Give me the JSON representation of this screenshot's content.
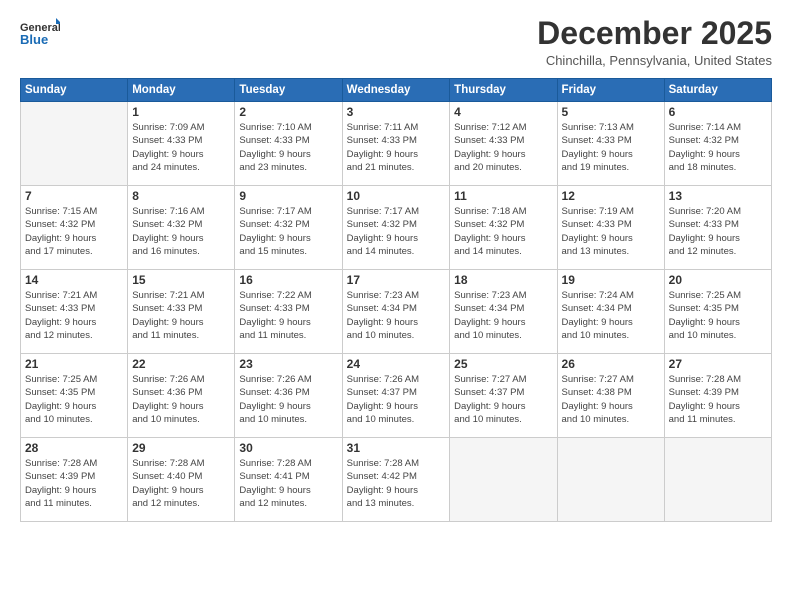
{
  "header": {
    "logo_line1": "General",
    "logo_line2": "Blue",
    "month": "December 2025",
    "location": "Chinchilla, Pennsylvania, United States"
  },
  "weekdays": [
    "Sunday",
    "Monday",
    "Tuesday",
    "Wednesday",
    "Thursday",
    "Friday",
    "Saturday"
  ],
  "weeks": [
    [
      {
        "day": "",
        "info": ""
      },
      {
        "day": "1",
        "info": "Sunrise: 7:09 AM\nSunset: 4:33 PM\nDaylight: 9 hours\nand 24 minutes."
      },
      {
        "day": "2",
        "info": "Sunrise: 7:10 AM\nSunset: 4:33 PM\nDaylight: 9 hours\nand 23 minutes."
      },
      {
        "day": "3",
        "info": "Sunrise: 7:11 AM\nSunset: 4:33 PM\nDaylight: 9 hours\nand 21 minutes."
      },
      {
        "day": "4",
        "info": "Sunrise: 7:12 AM\nSunset: 4:33 PM\nDaylight: 9 hours\nand 20 minutes."
      },
      {
        "day": "5",
        "info": "Sunrise: 7:13 AM\nSunset: 4:33 PM\nDaylight: 9 hours\nand 19 minutes."
      },
      {
        "day": "6",
        "info": "Sunrise: 7:14 AM\nSunset: 4:32 PM\nDaylight: 9 hours\nand 18 minutes."
      }
    ],
    [
      {
        "day": "7",
        "info": "Sunrise: 7:15 AM\nSunset: 4:32 PM\nDaylight: 9 hours\nand 17 minutes."
      },
      {
        "day": "8",
        "info": "Sunrise: 7:16 AM\nSunset: 4:32 PM\nDaylight: 9 hours\nand 16 minutes."
      },
      {
        "day": "9",
        "info": "Sunrise: 7:17 AM\nSunset: 4:32 PM\nDaylight: 9 hours\nand 15 minutes."
      },
      {
        "day": "10",
        "info": "Sunrise: 7:17 AM\nSunset: 4:32 PM\nDaylight: 9 hours\nand 14 minutes."
      },
      {
        "day": "11",
        "info": "Sunrise: 7:18 AM\nSunset: 4:32 PM\nDaylight: 9 hours\nand 14 minutes."
      },
      {
        "day": "12",
        "info": "Sunrise: 7:19 AM\nSunset: 4:33 PM\nDaylight: 9 hours\nand 13 minutes."
      },
      {
        "day": "13",
        "info": "Sunrise: 7:20 AM\nSunset: 4:33 PM\nDaylight: 9 hours\nand 12 minutes."
      }
    ],
    [
      {
        "day": "14",
        "info": "Sunrise: 7:21 AM\nSunset: 4:33 PM\nDaylight: 9 hours\nand 12 minutes."
      },
      {
        "day": "15",
        "info": "Sunrise: 7:21 AM\nSunset: 4:33 PM\nDaylight: 9 hours\nand 11 minutes."
      },
      {
        "day": "16",
        "info": "Sunrise: 7:22 AM\nSunset: 4:33 PM\nDaylight: 9 hours\nand 11 minutes."
      },
      {
        "day": "17",
        "info": "Sunrise: 7:23 AM\nSunset: 4:34 PM\nDaylight: 9 hours\nand 10 minutes."
      },
      {
        "day": "18",
        "info": "Sunrise: 7:23 AM\nSunset: 4:34 PM\nDaylight: 9 hours\nand 10 minutes."
      },
      {
        "day": "19",
        "info": "Sunrise: 7:24 AM\nSunset: 4:34 PM\nDaylight: 9 hours\nand 10 minutes."
      },
      {
        "day": "20",
        "info": "Sunrise: 7:25 AM\nSunset: 4:35 PM\nDaylight: 9 hours\nand 10 minutes."
      }
    ],
    [
      {
        "day": "21",
        "info": "Sunrise: 7:25 AM\nSunset: 4:35 PM\nDaylight: 9 hours\nand 10 minutes."
      },
      {
        "day": "22",
        "info": "Sunrise: 7:26 AM\nSunset: 4:36 PM\nDaylight: 9 hours\nand 10 minutes."
      },
      {
        "day": "23",
        "info": "Sunrise: 7:26 AM\nSunset: 4:36 PM\nDaylight: 9 hours\nand 10 minutes."
      },
      {
        "day": "24",
        "info": "Sunrise: 7:26 AM\nSunset: 4:37 PM\nDaylight: 9 hours\nand 10 minutes."
      },
      {
        "day": "25",
        "info": "Sunrise: 7:27 AM\nSunset: 4:37 PM\nDaylight: 9 hours\nand 10 minutes."
      },
      {
        "day": "26",
        "info": "Sunrise: 7:27 AM\nSunset: 4:38 PM\nDaylight: 9 hours\nand 10 minutes."
      },
      {
        "day": "27",
        "info": "Sunrise: 7:28 AM\nSunset: 4:39 PM\nDaylight: 9 hours\nand 11 minutes."
      }
    ],
    [
      {
        "day": "28",
        "info": "Sunrise: 7:28 AM\nSunset: 4:39 PM\nDaylight: 9 hours\nand 11 minutes."
      },
      {
        "day": "29",
        "info": "Sunrise: 7:28 AM\nSunset: 4:40 PM\nDaylight: 9 hours\nand 12 minutes."
      },
      {
        "day": "30",
        "info": "Sunrise: 7:28 AM\nSunset: 4:41 PM\nDaylight: 9 hours\nand 12 minutes."
      },
      {
        "day": "31",
        "info": "Sunrise: 7:28 AM\nSunset: 4:42 PM\nDaylight: 9 hours\nand 13 minutes."
      },
      {
        "day": "",
        "info": ""
      },
      {
        "day": "",
        "info": ""
      },
      {
        "day": "",
        "info": ""
      }
    ]
  ]
}
